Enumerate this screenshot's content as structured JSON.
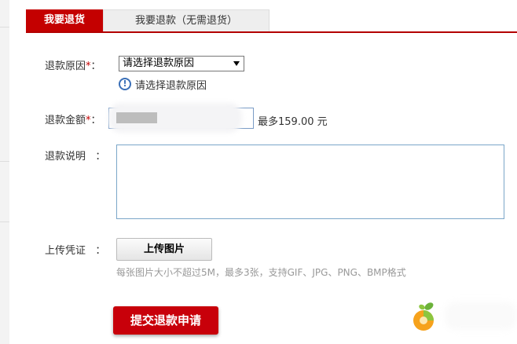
{
  "tabs": [
    {
      "label": "我要退货",
      "active": true
    },
    {
      "label": "我要退款（无需退货）",
      "active": false
    }
  ],
  "form": {
    "reason": {
      "label": "退款原因",
      "required_mark": "*",
      "colon": "：",
      "selected": "请选择退款原因",
      "hint": "请选择退款原因"
    },
    "amount": {
      "label": "退款金额",
      "required_mark": "*",
      "colon": "：",
      "value": "",
      "max_text": "最多159.00 元"
    },
    "description": {
      "label": "退款说明",
      "colon": "：",
      "value": ""
    },
    "evidence": {
      "label": "上传凭证",
      "colon": "：",
      "button_label": "上传图片",
      "hint": "每张图片大小不超过5M，最多3张，支持GIF、JPG、PNG、BMP格式"
    },
    "submit_label": "提交退款申请"
  },
  "colors": {
    "brand_red": "#c40000",
    "hint_blue": "#3a6fb7"
  },
  "icons": {
    "info": "info-circle-icon",
    "logo": "leaf-logo-icon"
  }
}
